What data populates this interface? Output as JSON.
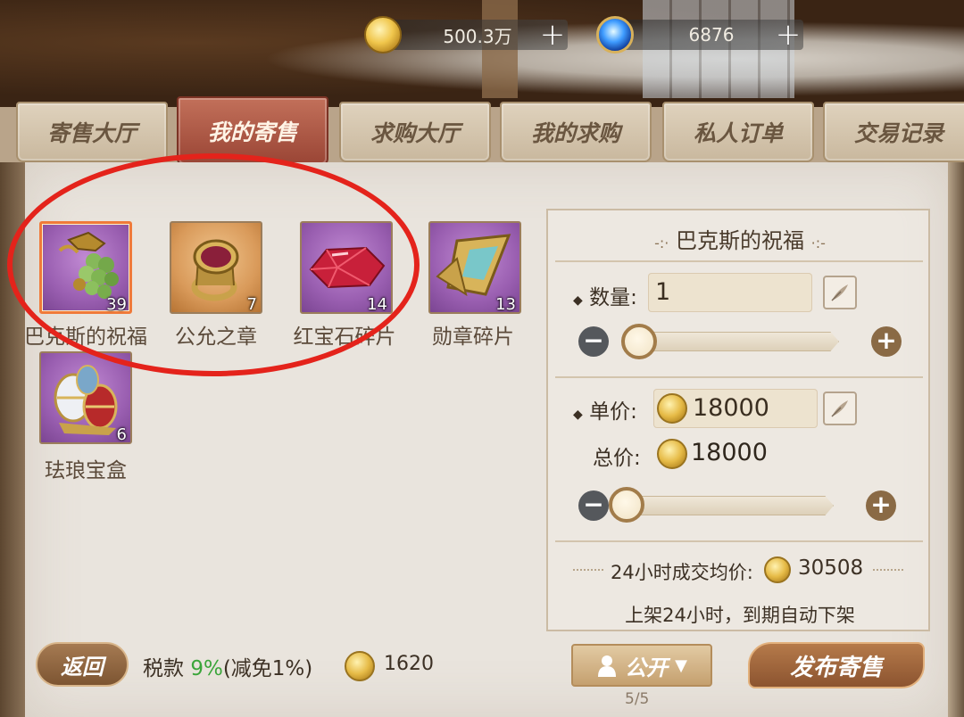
{
  "currency": {
    "gold": "500.3万",
    "gems": "6876"
  },
  "tabs": [
    {
      "label": "寄售大厅"
    },
    {
      "label": "我的寄售"
    },
    {
      "label": "求购大厅"
    },
    {
      "label": "我的求购"
    },
    {
      "label": "私人订单"
    },
    {
      "label": "交易记录"
    }
  ],
  "items": [
    {
      "name": "巴克斯的祝福",
      "count": "39"
    },
    {
      "name": "公允之章",
      "count": "7"
    },
    {
      "name": "红宝石碎片",
      "count": "14"
    },
    {
      "name": "勋章碎片",
      "count": "13"
    },
    {
      "name": "珐琅宝盒",
      "count": "6"
    }
  ],
  "detail": {
    "title": "巴克斯的祝福",
    "quantity_label": "数量:",
    "quantity": "1",
    "unit_price_label": "单价:",
    "unit_price": "18000",
    "total_label": "总价:",
    "total": "18000",
    "avg_label": "24小时成交均价:",
    "avg_value": "30508",
    "note": "上架24小时，到期自动下架"
  },
  "bottom": {
    "back": "返回",
    "tax_label": "税款 ",
    "tax_rate": "9%",
    "tax_reduction": "(减免1%)",
    "tax_value": "1620",
    "visibility": "公开",
    "publish": "发布寄售",
    "page": "5/5"
  }
}
